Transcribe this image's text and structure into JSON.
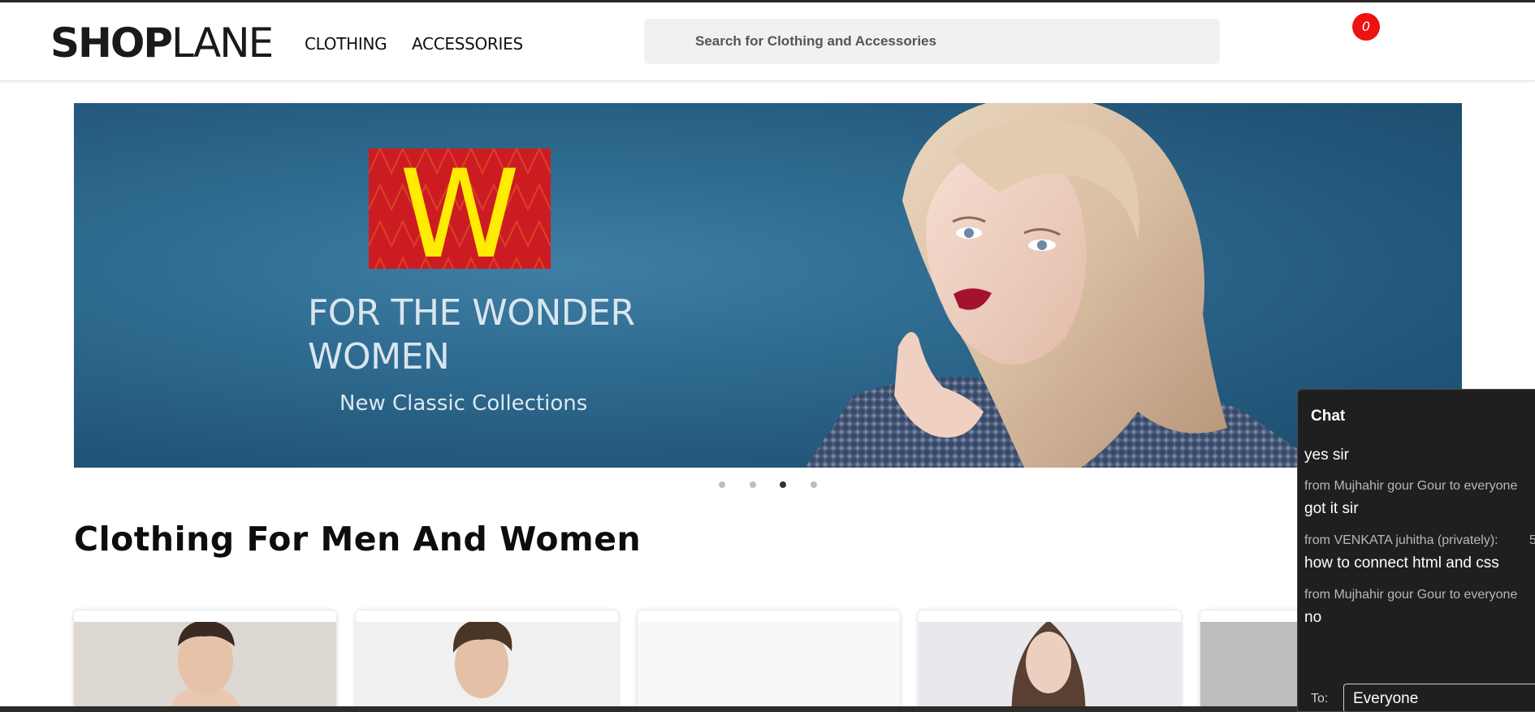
{
  "header": {
    "logo_bold": "SHOP",
    "logo_light": "LANE",
    "nav": [
      {
        "label": "CLOTHING"
      },
      {
        "label": "ACCESSORIES"
      }
    ],
    "search_placeholder": "Search for Clothing and Accessories",
    "cart_count": "0"
  },
  "hero": {
    "logo_letter": "W",
    "heading": "FOR THE WONDER WOMEN",
    "subheading": "New Classic Collections",
    "slide_count": 4,
    "active_slide": 3
  },
  "section": {
    "title": "Clothing For Men And Women"
  },
  "products": [
    {
      "image": "man-in-grey-tshirt"
    },
    {
      "image": "man-in-black-jacket"
    },
    {
      "image": "blank"
    },
    {
      "image": "woman-with-long-hair"
    },
    {
      "image": "grey-product"
    }
  ],
  "chat": {
    "title": "Chat",
    "messages": [
      {
        "meta": "",
        "text": "yes sir"
      },
      {
        "meta": "from Mujhahir gour Gour to everyone",
        "text": "got it sir"
      },
      {
        "meta": "from VENKATA juhitha (privately):",
        "meta_extra": "5",
        "text": "how to connect html and css"
      },
      {
        "meta": "from Mujhahir gour Gour to everyone",
        "text": "no"
      }
    ],
    "to_label": "To:",
    "to_value": "Everyone"
  },
  "colors": {
    "cart_badge": "#ee1111",
    "w_logo_bg": "#cc1c22",
    "w_logo_letter": "#ffec00",
    "hero_bg": "#2f6b90",
    "chat_bg": "#1f1f1f"
  }
}
